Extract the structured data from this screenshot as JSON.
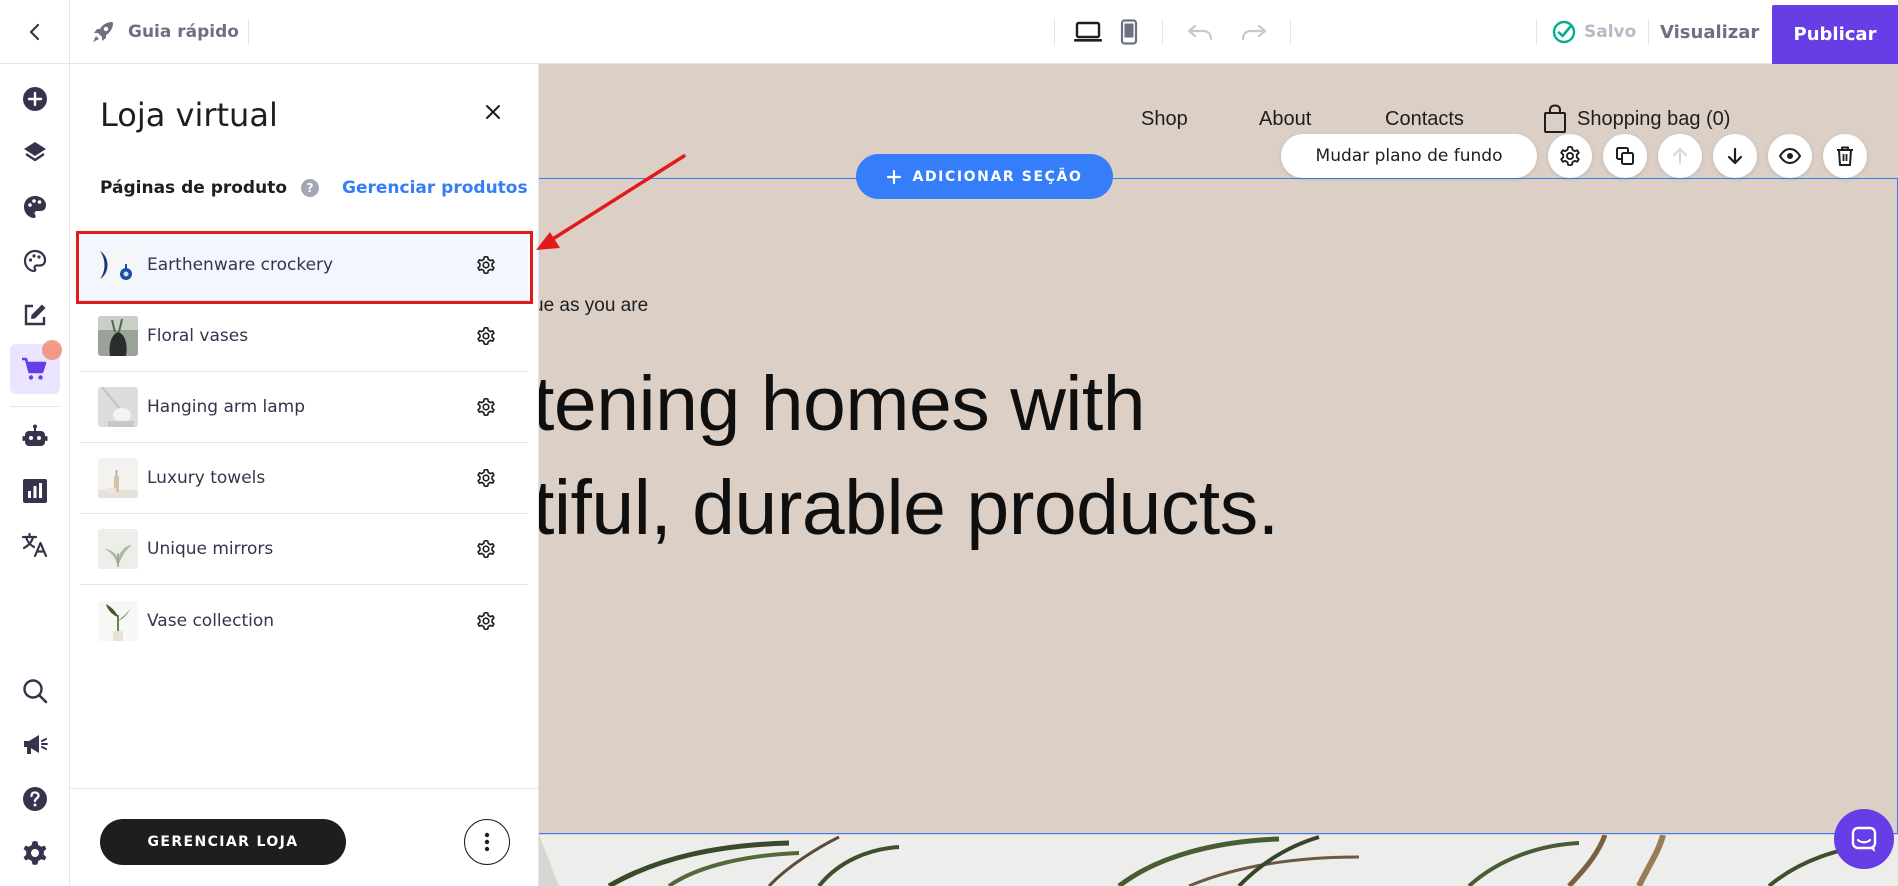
{
  "topbar": {
    "guide_label": "Guia rápido",
    "saved_label": "Salvo",
    "preview_label": "Visualizar",
    "publish_label": "Publicar"
  },
  "panel": {
    "title": "Loja virtual",
    "pages_heading": "Páginas de produto",
    "help_mark": "?",
    "manage_products_label": "Gerenciar produtos",
    "products": [
      {
        "name": "Earthenware crockery",
        "selected": true
      },
      {
        "name": "Floral vases"
      },
      {
        "name": "Hanging arm lamp"
      },
      {
        "name": "Luxury towels"
      },
      {
        "name": "Unique mirrors"
      },
      {
        "name": "Vase collection"
      }
    ],
    "manage_store_label": "GERENCIAR LOJA"
  },
  "canvas": {
    "nav": {
      "shop": "Shop",
      "about": "About",
      "contacts": "Contacts",
      "bag": "Shopping bag (0)"
    },
    "add_section_label": "ADICIONAR SEÇÃO",
    "change_background_label": "Mudar plano de fundo",
    "hero_small": "ue as you are",
    "hero_line_1": "tening homes with",
    "hero_line_2": "tiful, durable products."
  },
  "colors": {
    "accent": "#673de6",
    "link": "#357df9",
    "canvas_bg": "#dccfc6",
    "highlight": "#e11b1b",
    "saved_check": "#00b090"
  }
}
